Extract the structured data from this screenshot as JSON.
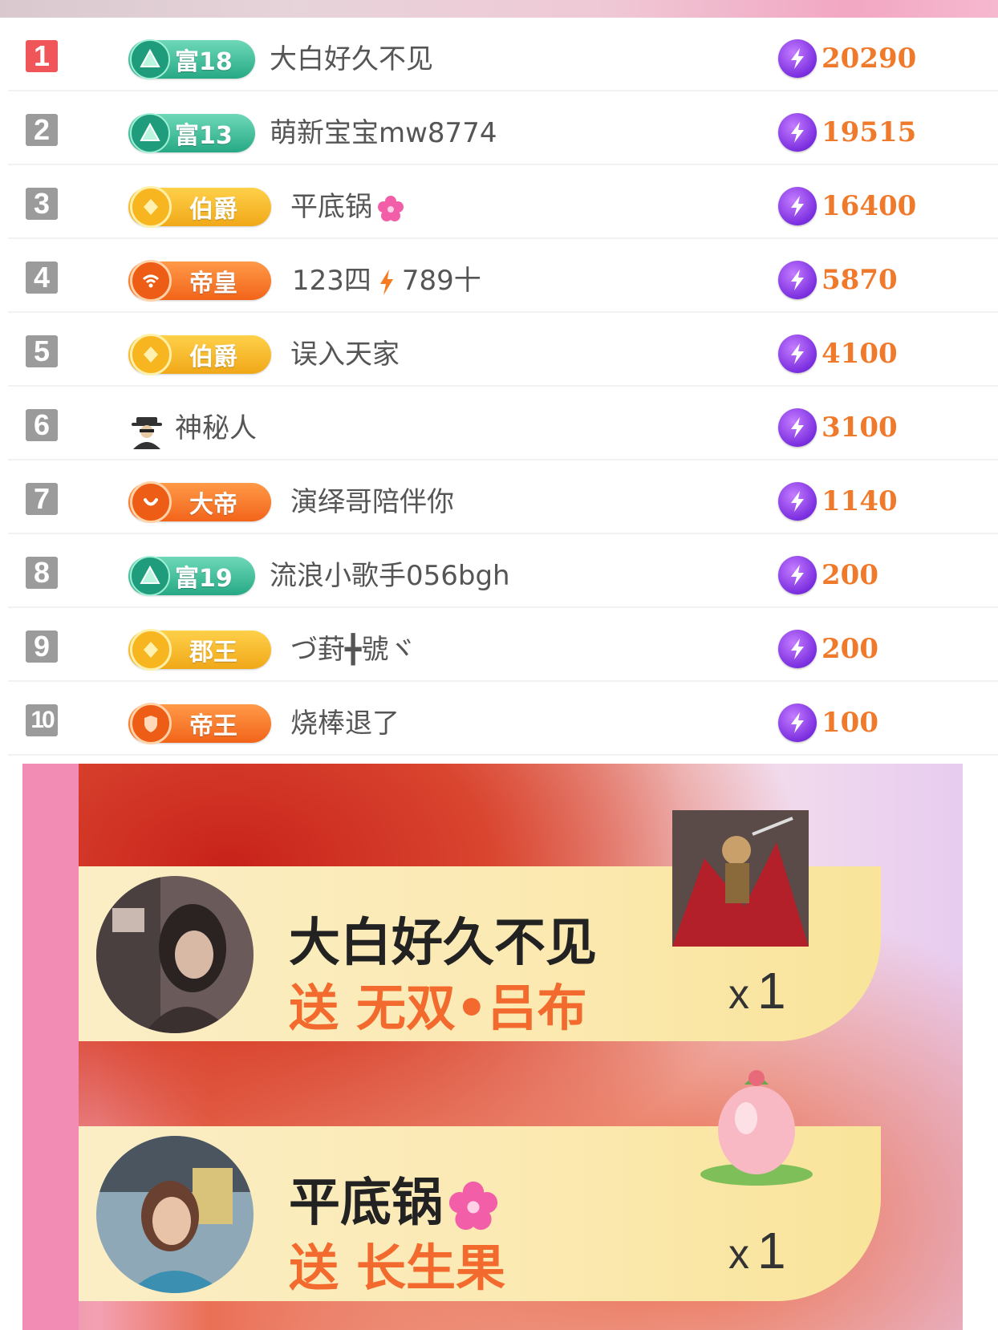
{
  "colors": {
    "first_rank": "#f0555a",
    "rank_default": "#9b9b9b",
    "score_text": "#f07a2c",
    "coin": "#7b2fe0",
    "wealth_badge": "#2fae8b",
    "gold_badge": "#f6b526",
    "orange_badge": "#f26a1f",
    "gift_text": "#f26a2e",
    "side_bar": "#f38cb4"
  },
  "leaderboard": [
    {
      "rank": "1",
      "badge_type": "wealth",
      "badge_icon": "triangle-icon",
      "badge_label": "富18",
      "name": "大白好久不见",
      "score": "20290"
    },
    {
      "rank": "2",
      "badge_type": "wealth",
      "badge_icon": "triangle-icon",
      "badge_label": "富13",
      "name": "萌新宝宝mw8774",
      "score": "19515"
    },
    {
      "rank": "3",
      "badge_type": "noble-gold",
      "badge_icon": "gem-icon",
      "badge_label": "伯爵",
      "name": "平底锅",
      "name_icon": "flower-icon",
      "score": "16400"
    },
    {
      "rank": "4",
      "badge_type": "noble-orange",
      "badge_icon": "wifi-icon",
      "badge_label": "帝皇",
      "name_part1": "123四",
      "name_icon": "lightning-icon",
      "name_part2": "789十",
      "score": "5870"
    },
    {
      "rank": "5",
      "badge_type": "noble-gold",
      "badge_icon": "gem-icon",
      "badge_label": "伯爵",
      "name": "误入天家",
      "score": "4100"
    },
    {
      "rank": "6",
      "badge_type": "none",
      "badge_icon": "mystery-person-icon",
      "name": "神秘人",
      "score": "3100"
    },
    {
      "rank": "7",
      "badge_type": "noble-orange",
      "badge_icon": "smile-icon",
      "badge_label": "大帝",
      "name": "演绎哥陪伴你",
      "score": "1140"
    },
    {
      "rank": "8",
      "badge_type": "wealth",
      "badge_icon": "triangle-icon",
      "badge_label": "富19",
      "name": "流浪小歌手056bgh",
      "score": "200"
    },
    {
      "rank": "9",
      "badge_type": "noble-gold",
      "badge_icon": "gem-icon",
      "badge_label": "郡王",
      "name": "づ葑╋號ヾ",
      "score": "200"
    },
    {
      "rank": "10",
      "badge_type": "noble-orange",
      "badge_icon": "shield-icon",
      "badge_label": "帝王",
      "name": "烧棒退了",
      "score": "100"
    }
  ],
  "gifts": [
    {
      "sender": "大白好久不见",
      "verb": "送",
      "gift": "无双•吕布",
      "gift_icon": "lubu-warrior-icon",
      "count_prefix": "x",
      "count": "1"
    },
    {
      "sender": "平底锅",
      "sender_icon": "flower-icon",
      "verb": "送",
      "gift": "长生果",
      "gift_icon": "peach-fruit-icon",
      "count_prefix": "x",
      "count": "1"
    }
  ]
}
